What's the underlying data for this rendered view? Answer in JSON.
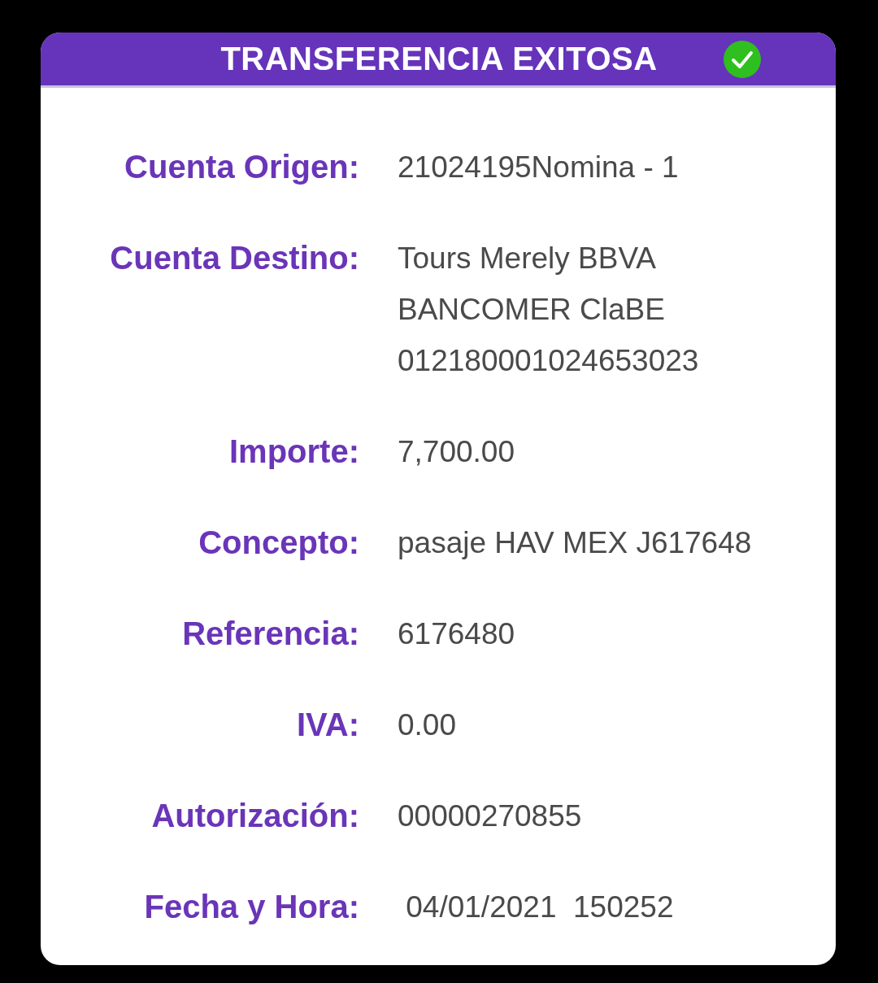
{
  "header": {
    "title": "TRANSFERENCIA EXITOSA",
    "success": true
  },
  "fields": [
    {
      "label": "Cuenta Origen:",
      "value": "21024195Nomina - 1"
    },
    {
      "label": "Cuenta Destino:",
      "value": "Tours Merely BBVA BANCOMER ClaBE 012180001024653023"
    },
    {
      "label": "Importe:",
      "value": "7,700.00"
    },
    {
      "label": "Concepto:",
      "value": "pasaje HAV MEX J617648"
    },
    {
      "label": "Referencia:",
      "value": "6176480"
    },
    {
      "label": "IVA:",
      "value": "0.00"
    },
    {
      "label": "Autorización:",
      "value": "00000270855"
    },
    {
      "label": "Fecha y Hora:",
      "value": " 04/01/2021  150252"
    }
  ]
}
